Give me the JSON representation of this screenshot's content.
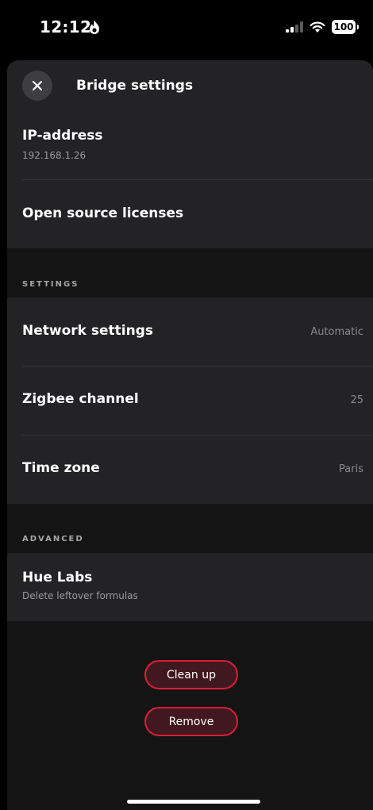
{
  "status_bar": {
    "time": "12:12",
    "battery": "100"
  },
  "header": {
    "title": "Bridge settings"
  },
  "info": {
    "ip_label": "IP-address",
    "ip_value": "192.168.1.26",
    "licenses_label": "Open source licenses"
  },
  "settings": {
    "section_title": "SETTINGS",
    "network_label": "Network settings",
    "network_value": "Automatic",
    "zigbee_label": "Zigbee channel",
    "zigbee_value": "25",
    "timezone_label": "Time zone",
    "timezone_value": "Paris"
  },
  "advanced": {
    "section_title": "ADVANCED",
    "huelabs_label": "Hue Labs",
    "huelabs_sub": "Delete leftover formulas"
  },
  "actions": {
    "clean_up_label": "Clean up",
    "remove_label": "Remove"
  },
  "colors": {
    "accent_border": "#d81f35",
    "button_fill": "#421820",
    "card": "#232325",
    "background": "#141414"
  }
}
